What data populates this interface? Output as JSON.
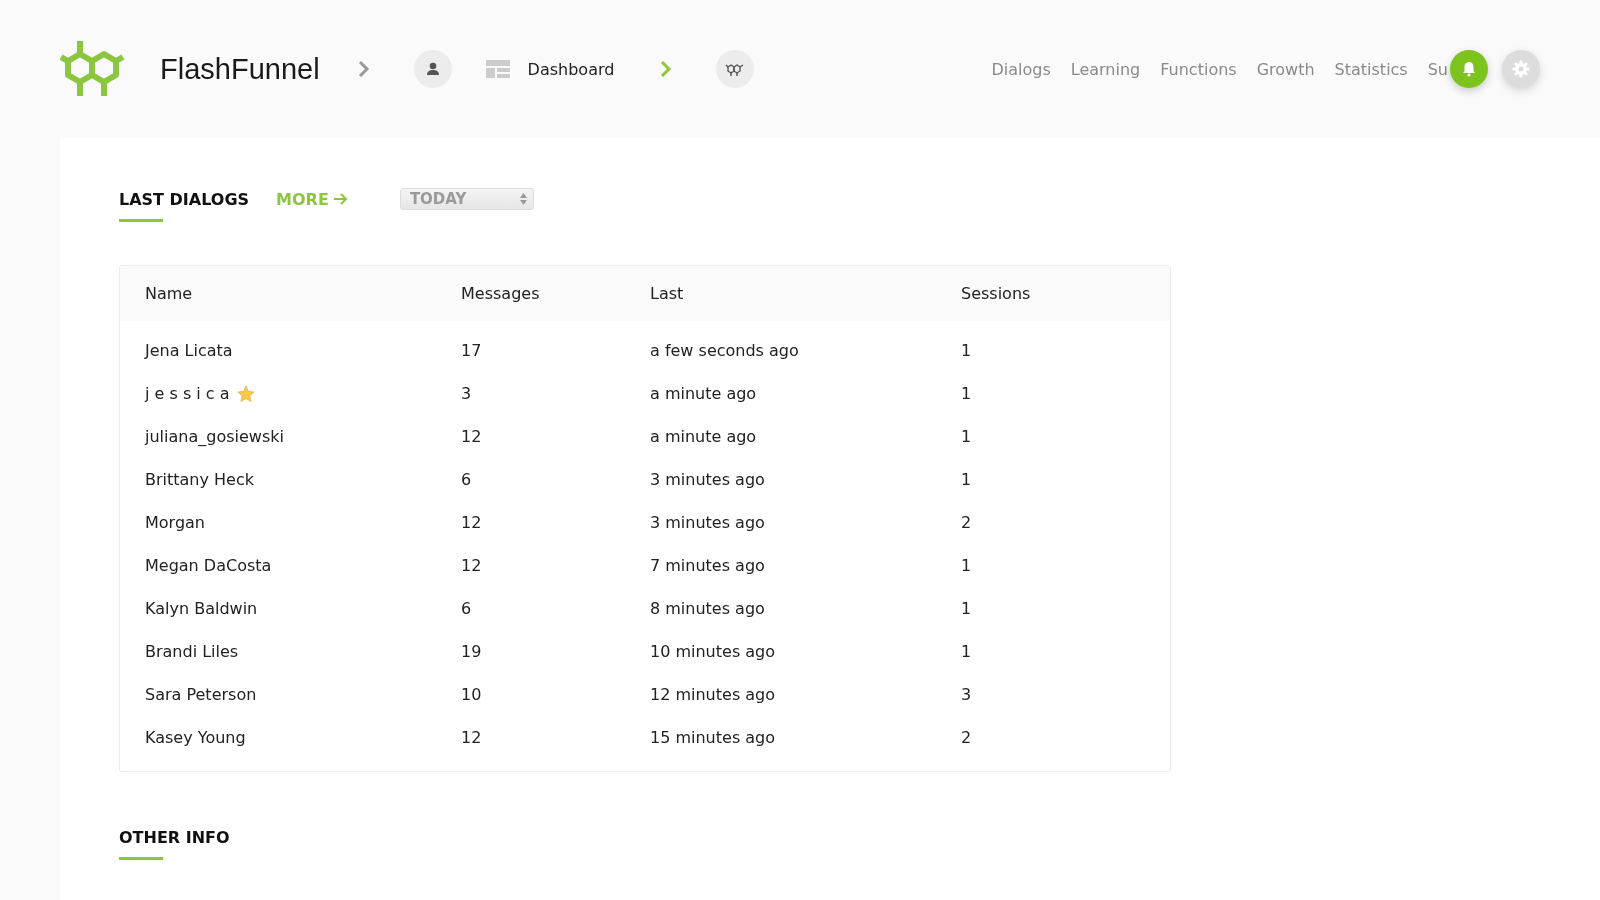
{
  "brand": {
    "name": "FlashFunnel"
  },
  "breadcrumb": {
    "page": "Dashboard"
  },
  "nav": [
    {
      "label": "Dialogs"
    },
    {
      "label": "Learning"
    },
    {
      "label": "Functions"
    },
    {
      "label": "Growth"
    },
    {
      "label": "Statistics"
    },
    {
      "label": "Su"
    }
  ],
  "section": {
    "title": "LAST DIALOGS",
    "more": "MORE",
    "range": "TODAY"
  },
  "table": {
    "columns": [
      "Name",
      "Messages",
      "Last",
      "Sessions"
    ],
    "rows": [
      {
        "name": "Jena Licata",
        "messages": "17",
        "last": "a few seconds ago",
        "sessions": "1",
        "star": false
      },
      {
        "name": "j e s s i c a",
        "messages": "3",
        "last": "a minute ago",
        "sessions": "1",
        "star": true
      },
      {
        "name": "juliana_gosiewski",
        "messages": "12",
        "last": "a minute ago",
        "sessions": "1",
        "star": false
      },
      {
        "name": "Brittany Heck",
        "messages": "6",
        "last": "3 minutes ago",
        "sessions": "1",
        "star": false
      },
      {
        "name": "Morgan",
        "messages": "12",
        "last": "3 minutes ago",
        "sessions": "2",
        "star": false
      },
      {
        "name": "Megan DaCosta",
        "messages": "12",
        "last": "7 minutes ago",
        "sessions": "1",
        "star": false
      },
      {
        "name": "Kalyn Baldwin",
        "messages": "6",
        "last": "8 minutes ago",
        "sessions": "1",
        "star": false
      },
      {
        "name": "Brandi Liles",
        "messages": "19",
        "last": "10 minutes ago",
        "sessions": "1",
        "star": false
      },
      {
        "name": "Sara Peterson",
        "messages": "10",
        "last": "12 minutes ago",
        "sessions": "3",
        "star": false
      },
      {
        "name": "Kasey Young",
        "messages": "12",
        "last": "15 minutes ago",
        "sessions": "2",
        "star": false
      }
    ]
  },
  "other": {
    "title": "OTHER INFO"
  }
}
